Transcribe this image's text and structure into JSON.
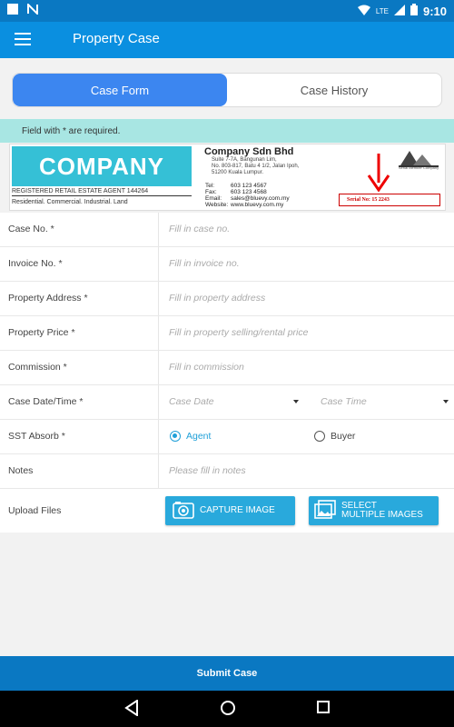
{
  "status_bar": {
    "lte": "LTE",
    "time": "9:10"
  },
  "app_bar": {
    "title": "Property Case"
  },
  "tabs": [
    {
      "label": "Case Form",
      "active": true
    },
    {
      "label": "Case History",
      "active": false
    }
  ],
  "notice": "Field with * are required.",
  "banner": {
    "company_logo_text": "COMPANY",
    "agent_line": "REGISTERED RETAIL ESTATE AGENT   144264",
    "categories": "Residential. Commercial. Industrial. Land",
    "company_name": "Company Sdn Bhd",
    "address_lines": [
      "Suite 7-7A, Bangunan Lim,",
      "No. 803-817, Batu 4 1/2, Jalan Ipoh,",
      "51200 Kuala Lumpur."
    ],
    "tel_label": "Tel:",
    "tel": "603 123 4567",
    "fax_label": "Fax:",
    "fax": "603 123 4568",
    "email_label": "Email:",
    "email": "sales@bluevy.com.my",
    "website_label": "Website:",
    "website": "www.bluevy.com.my",
    "serial_label": "Serial No: 15 2243",
    "association_text": "Serial Member Company"
  },
  "form": {
    "case_no": {
      "label": "Case No. *",
      "placeholder": "Fill in case no."
    },
    "invoice_no": {
      "label": "Invoice No. *",
      "placeholder": "Fill in invoice no."
    },
    "property_address": {
      "label": "Property Address *",
      "placeholder": "Fill in property address"
    },
    "property_price": {
      "label": "Property Price *",
      "placeholder": "Fill in property selling/rental price"
    },
    "commission": {
      "label": "Commission *",
      "placeholder": "Fill in commission"
    },
    "case_datetime": {
      "label": "Case Date/Time *",
      "date_placeholder": "Case Date",
      "time_placeholder": "Case Time"
    },
    "sst_absorb": {
      "label": "SST Absorb *",
      "options": [
        "Agent",
        "Buyer"
      ],
      "selected": "Agent"
    },
    "notes": {
      "label": "Notes",
      "placeholder": "Please fill in notes"
    },
    "upload": {
      "label": "Upload Files",
      "capture_label": "CAPTURE IMAGE",
      "select_line1": "SELECT",
      "select_line2": "MULTIPLE IMAGES"
    }
  },
  "submit_label": "Submit Case",
  "colors": {
    "primary": "#0a8fe0",
    "dark_primary": "#0a78c2",
    "accent": "#29a9dc",
    "notice_bg": "#a8e6e3",
    "tab_active": "#3c86f0"
  },
  "icons": [
    "notification-n-icon",
    "wifi-icon",
    "signal-icon",
    "battery-icon",
    "menu-icon",
    "camera-icon",
    "images-icon",
    "back-icon",
    "home-icon",
    "recents-icon",
    "down-arrow-icon"
  ]
}
